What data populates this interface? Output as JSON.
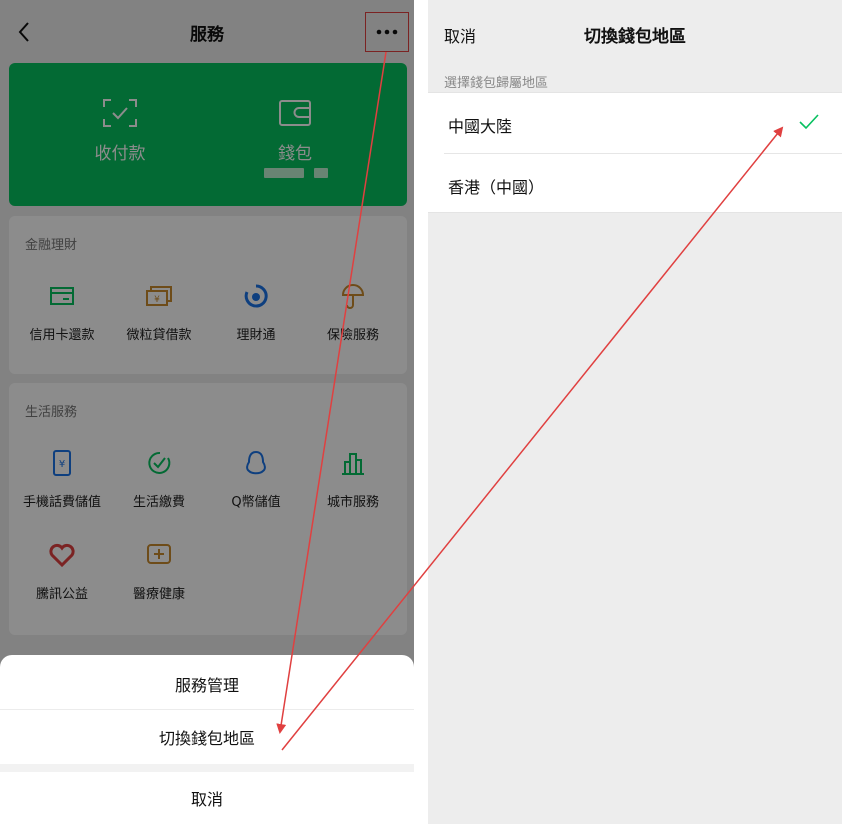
{
  "left": {
    "header": {
      "title": "服務",
      "back_icon": "chevron-left-icon",
      "more_icon": "more-dots-icon"
    },
    "wallet_card": {
      "color": "#07c160",
      "items": [
        {
          "label": "收付款",
          "icon": "scan-icon"
        },
        {
          "label": "錢包",
          "icon": "wallet-icon"
        }
      ]
    },
    "finance": {
      "title": "金融理財",
      "items": [
        {
          "label": "信用卡還款",
          "icon": "credit-card-icon",
          "color": "#07c160"
        },
        {
          "label": "微粒貸借款",
          "icon": "loan-icon",
          "color": "#c98a2e"
        },
        {
          "label": "理財通",
          "icon": "wealth-icon",
          "color": "#1a73e8"
        },
        {
          "label": "保險服務",
          "icon": "umbrella-icon",
          "color": "#c98a2e"
        }
      ]
    },
    "life": {
      "title": "生活服務",
      "items": [
        {
          "label": "手機話費儲值",
          "icon": "phone-icon",
          "color": "#1a73e8"
        },
        {
          "label": "生活繳費",
          "icon": "check-circle-icon",
          "color": "#07c160"
        },
        {
          "label": "Q幣儲值",
          "icon": "penguin-icon",
          "color": "#1a73e8"
        },
        {
          "label": "城市服務",
          "icon": "city-icon",
          "color": "#07c160"
        },
        {
          "label": "騰訊公益",
          "icon": "heart-icon",
          "color": "#e04040"
        },
        {
          "label": "醫療健康",
          "icon": "medical-icon",
          "color": "#c98a2e"
        }
      ]
    },
    "sheet": {
      "items": [
        {
          "label": "服務管理"
        },
        {
          "label": "切換錢包地區"
        }
      ],
      "cancel_label": "取消"
    }
  },
  "right": {
    "header": {
      "cancel_label": "取消",
      "title": "切換錢包地區"
    },
    "subtitle": "選擇錢包歸屬地區",
    "regions": [
      {
        "label": "中國大陸",
        "selected": true
      },
      {
        "label": "香港（中國）",
        "selected": false
      }
    ],
    "check_icon": "checkmark-icon",
    "check_color": "#07c160"
  },
  "annotation": {
    "color": "#e04040"
  }
}
